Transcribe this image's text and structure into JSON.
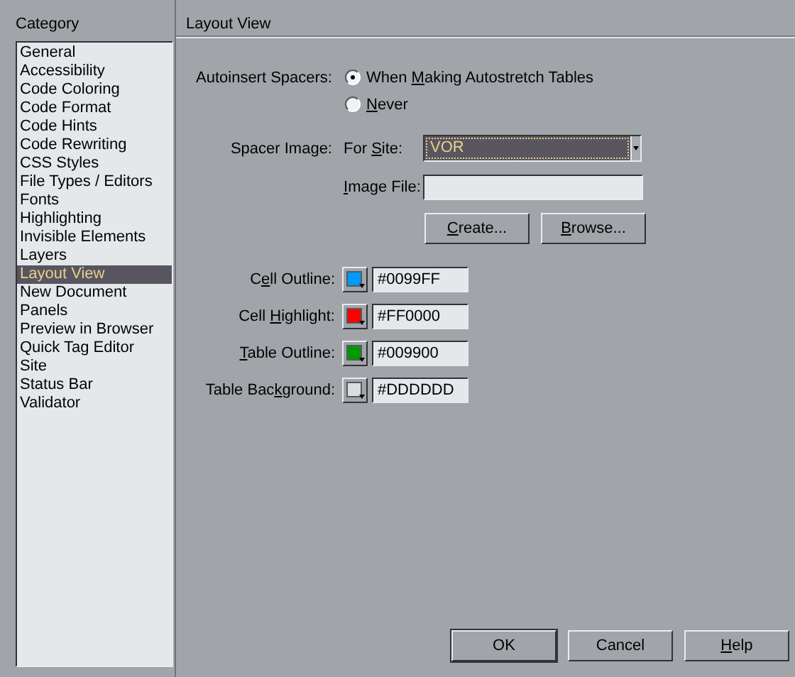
{
  "category_header": "Category",
  "categories": [
    {
      "label": "General",
      "selected": false
    },
    {
      "label": "Accessibility",
      "selected": false
    },
    {
      "label": "Code Coloring",
      "selected": false
    },
    {
      "label": "Code Format",
      "selected": false
    },
    {
      "label": "Code Hints",
      "selected": false
    },
    {
      "label": "Code Rewriting",
      "selected": false
    },
    {
      "label": "CSS Styles",
      "selected": false
    },
    {
      "label": "File Types / Editors",
      "selected": false
    },
    {
      "label": "Fonts",
      "selected": false
    },
    {
      "label": "Highlighting",
      "selected": false
    },
    {
      "label": "Invisible Elements",
      "selected": false
    },
    {
      "label": "Layers",
      "selected": false
    },
    {
      "label": "Layout View",
      "selected": true
    },
    {
      "label": "New Document",
      "selected": false
    },
    {
      "label": "Panels",
      "selected": false
    },
    {
      "label": "Preview in Browser",
      "selected": false
    },
    {
      "label": "Quick Tag Editor",
      "selected": false
    },
    {
      "label": "Site",
      "selected": false
    },
    {
      "label": "Status Bar",
      "selected": false
    },
    {
      "label": "Validator",
      "selected": false
    }
  ],
  "panel_title": "Layout View",
  "autoinsert": {
    "label": "Autoinsert Spacers:",
    "options": [
      {
        "label": {
          "pre": "When ",
          "key": "M",
          "post": "aking Autostretch Tables"
        },
        "selected": true
      },
      {
        "label": {
          "key": "N",
          "post": "ever"
        },
        "selected": false
      }
    ]
  },
  "spacer_image": {
    "label": "Spacer Image:",
    "site_label": {
      "pre": "For ",
      "key": "S",
      "post": "ite:"
    },
    "site_value": "VOR",
    "file_label": {
      "key": "I",
      "post": "mage File:"
    }
  },
  "file_buttons": [
    {
      "key": "C",
      "post": "reate..."
    },
    {
      "key": "B",
      "post": "rowse..."
    }
  ],
  "colors": [
    {
      "label": {
        "pre": "C",
        "key": "e",
        "post": "ll Outline:"
      },
      "color": "#0099ff",
      "value": "#0099FF"
    },
    {
      "label": {
        "pre": "Cell ",
        "key": "H",
        "post": "ighlight:"
      },
      "color": "#ff0000",
      "value": "#FF0000"
    },
    {
      "label": {
        "key": "T",
        "post": "able Outline:"
      },
      "color": "#009900",
      "value": "#009900"
    },
    {
      "label": {
        "pre": "Table Bac",
        "key": "k",
        "post": "ground:"
      },
      "color": "#dddddd",
      "value": "#DDDDDD"
    }
  ],
  "footer_buttons": [
    {
      "post": "OK"
    },
    {
      "post": "Cancel"
    },
    {
      "key": "H",
      "post": "elp"
    }
  ]
}
